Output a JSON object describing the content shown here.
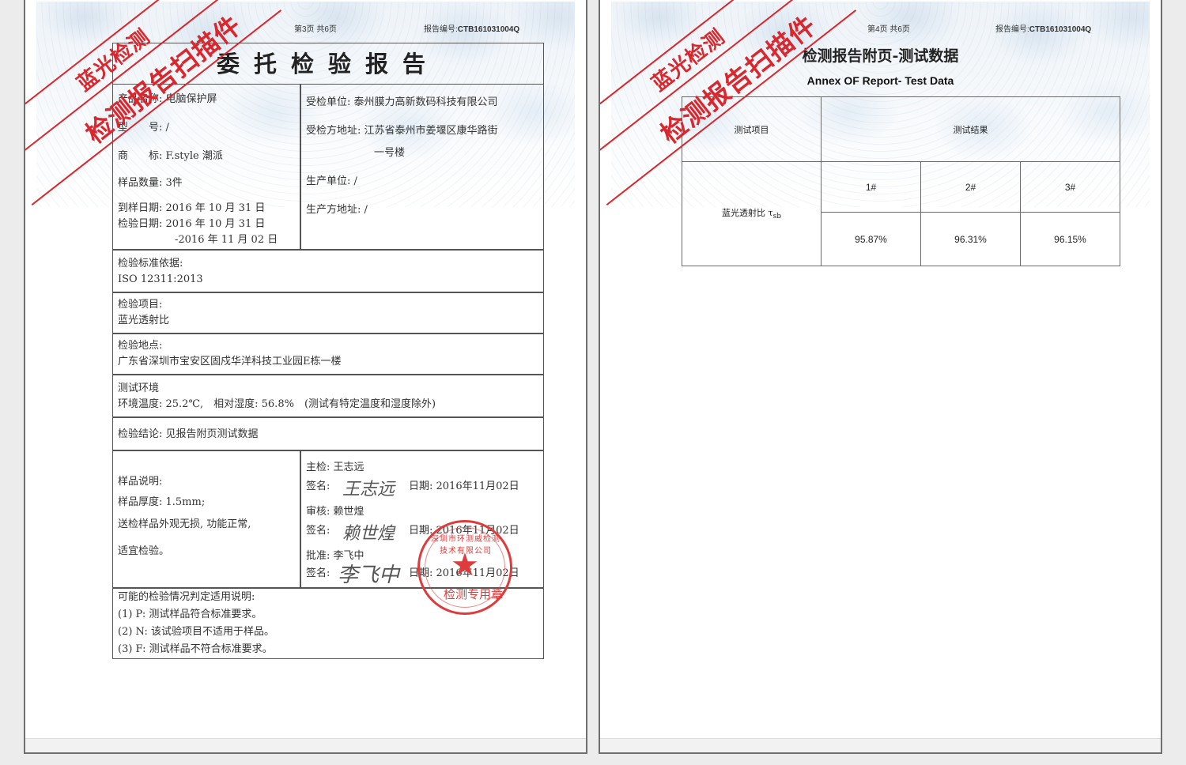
{
  "watermark": {
    "line1": "蓝光检测",
    "line2": "检测报告扫描件"
  },
  "left_page": {
    "page_number": "第3页 共6页",
    "report_no_label": "报告编号:",
    "report_no": "CTB161031004Q",
    "title": "委托检验报告",
    "product_name": "产品名称: 电脑保护屏",
    "model": "型　　号: /",
    "trademark": "商　　标: F.style 潮派",
    "sample_qty": "样品数量: 3件",
    "arrival_date": "到样日期: 2016 年 10 月 31 日",
    "test_date": "检验日期: 2016 年 10 月 31 日",
    "test_date_end": "-2016 年 11 月 02 日",
    "client": "受检单位: 泰州膜力高新数码科技有限公司",
    "client_address": "受检方地址: 江苏省泰州市姜堰区康华路街",
    "client_address_2": "一号楼",
    "manufacturer": "生产单位: /",
    "manufacturer_address": "生产方地址: /",
    "standard_label": "检验标准依据:",
    "standard_value": "ISO 12311:2013",
    "items_label": "检验项目:",
    "items_value": "蓝光透射比",
    "location_label": "检验地点:",
    "location_value": "广东省深圳市宝安区固戍华洋科技工业园E栋一楼",
    "env_label": "测试环境",
    "env_value": "环境温度: 25.2℃,　相对湿度: 56.8%　(测试有特定温度和湿度除外)",
    "conclusion": "检验结论: 见报告附页测试数据",
    "sample_desc_label": "样品说明:",
    "sample_thickness": "样品厚度: 1.5mm;",
    "sample_appearance": "送检样品外观无损, 功能正常,",
    "sample_suitable": "适宜检验。",
    "inspector_label": "主检: 王志远",
    "inspector_sign_label": "签名:",
    "inspector_sign": "王志远",
    "inspector_date": "日期: 2016年11月02日",
    "reviewer_label": "审核: 赖世煌",
    "reviewer_sign_label": "签名:",
    "reviewer_sign": "赖世煌",
    "reviewer_date": "日期: 2016年11月02日",
    "approver_label": "批准: 李飞中",
    "approver_sign_label": "签名:",
    "approver_sign": "李飞中",
    "approver_date": "日期: 2016年11月02日",
    "seal_text": "检测专用章",
    "seal_arc": "深圳市环测威检测技术有限公司",
    "notes_title": "可能的检验情况判定适用说明:",
    "note_1": "(1) P: 测试样品符合标准要求。",
    "note_2": "(2) N: 该试验项目不适用于样品。",
    "note_3": "(3) F: 测试样品不符合标准要求。"
  },
  "right_page": {
    "page_number": "第4页 共6页",
    "report_no_label": "报告编号:",
    "report_no": "CTB161031004Q",
    "title": "检测报告附页-测试数据",
    "subtitle": "Annex OF Report- Test Data",
    "table": {
      "col_item": "测试项目",
      "col_result": "测试结果",
      "row_label": "蓝光透射比 τ",
      "row_label_sub": "sb",
      "samples": [
        "1#",
        "2#",
        "3#"
      ],
      "values": [
        "95.87%",
        "96.31%",
        "96.15%"
      ]
    }
  }
}
